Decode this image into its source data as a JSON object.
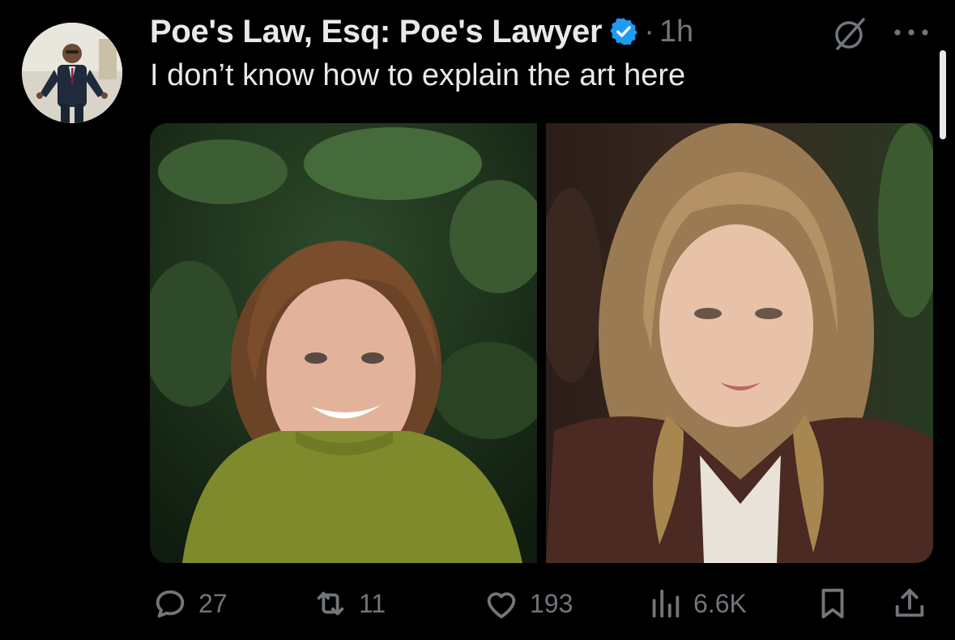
{
  "post": {
    "display_name": "Poe's Law, Esq: Poe's Lawyer",
    "separator": "·",
    "timestamp": "1h",
    "text": "I don’t know how to explain the art here"
  },
  "media": {
    "images": [
      {
        "subject": "woman-green-sweater"
      },
      {
        "subject": "woman-leather-jacket"
      }
    ]
  },
  "actions": {
    "replies": "27",
    "reposts": "11",
    "likes": "193",
    "views": "6.6K"
  },
  "colors": {
    "background": "#000000",
    "primary_text": "#e7e9ea",
    "secondary_text": "#71767b",
    "verified_badge": "#1d9bf0"
  },
  "icons": [
    "verified-badge-icon",
    "grok-icon",
    "more-icon",
    "reply-icon",
    "repost-icon",
    "like-icon",
    "views-icon",
    "bookmark-icon",
    "share-icon"
  ]
}
